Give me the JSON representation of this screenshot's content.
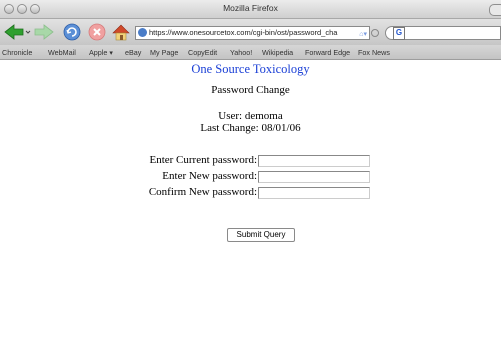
{
  "window": {
    "title": "Mozilla Firefox"
  },
  "toolbar": {
    "url": "https://www.onesourcetox.com/cgi-bin/ost/password_cha",
    "icons": [
      "back-arrow",
      "forward-arrow",
      "reload",
      "stop",
      "home",
      "secure-lock",
      "rss",
      "search-engine-g"
    ]
  },
  "bookmarks": [
    "Chronicle",
    "WebMail",
    "Apple ▾",
    "eBay",
    "My Page",
    "CopyEdit",
    "Yahoo!",
    "Wikipedia",
    "Forward Edge",
    "Fox News"
  ],
  "page": {
    "site_title": "One Source Toxicology",
    "heading": "Password Change",
    "user_line": "User: demoma",
    "last_change_line": "Last Change: 08/01/06",
    "form": {
      "current_label": "Enter Current password:",
      "new_label": "Enter New password:",
      "confirm_label": "Confirm New password:",
      "submit_label": "Submit Query"
    }
  },
  "colors": {
    "site_title": "#1a3fd6",
    "chrome": "#d0d0d0"
  }
}
